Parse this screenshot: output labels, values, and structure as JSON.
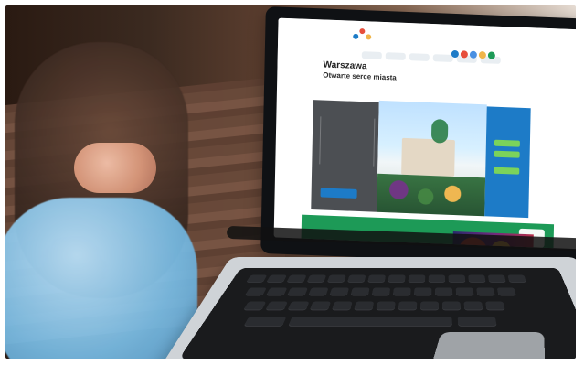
{
  "photo": {
    "description": "",
    "icons": [
      "laptop-icon",
      "person-icon"
    ]
  },
  "website": {
    "page_title": "Warszawa",
    "page_subtitle": "Otwarte serce miasta",
    "colors": {
      "blue": "#1d7bc7",
      "green": "#1d9a57",
      "dark": "#4c4f53"
    }
  }
}
